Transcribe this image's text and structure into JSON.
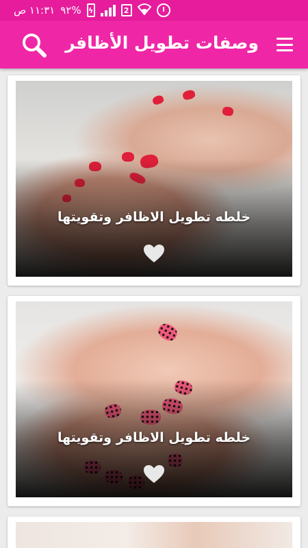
{
  "status_bar": {
    "time": "١١:٣١ ص",
    "battery": "٩٢%",
    "sim_number": "2"
  },
  "app_bar": {
    "title": "وصفات تطويل الأظافر",
    "search_icon": "search-icon",
    "menu_icon": "menu-icon"
  },
  "cards": [
    {
      "caption": "خلطه تطويل الاظافر وتقويتها",
      "favorite_icon": "heart-icon"
    },
    {
      "caption": "خلطه تطويل الاظافر وتقويتها",
      "favorite_icon": "heart-icon"
    }
  ],
  "colors": {
    "status_bar": "#e61c9c",
    "app_bar": "#ef27a6",
    "background": "#ececec"
  }
}
